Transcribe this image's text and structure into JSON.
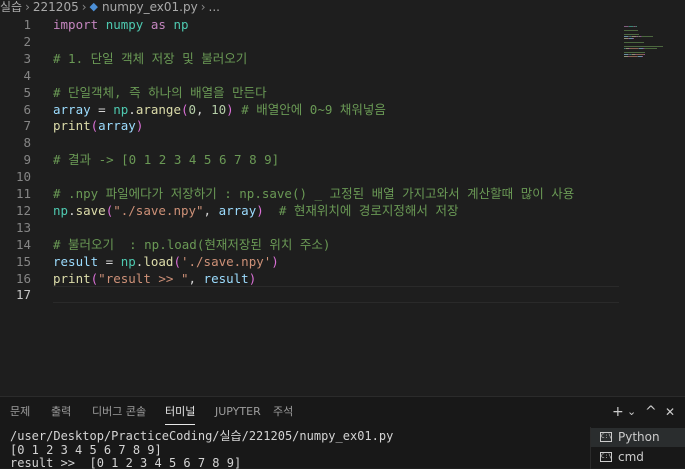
{
  "breadcrumb": {
    "items": [
      "실습",
      "221205",
      "numpy_ex01.py",
      "..."
    ]
  },
  "editor": {
    "lines": [
      {
        "n": "1",
        "tokens": [
          [
            "keyword",
            "import"
          ],
          [
            "plain",
            " "
          ],
          [
            "module",
            "numpy"
          ],
          [
            "plain",
            " "
          ],
          [
            "keyword",
            "as"
          ],
          [
            "plain",
            " "
          ],
          [
            "module",
            "np"
          ]
        ]
      },
      {
        "n": "2",
        "tokens": []
      },
      {
        "n": "3",
        "tokens": [
          [
            "comment",
            "# 1. 단일 객체 저장 및 불러오기"
          ]
        ]
      },
      {
        "n": "4",
        "tokens": []
      },
      {
        "n": "5",
        "tokens": [
          [
            "comment",
            "# 단일객체, 즉 하나의 배열을 만든다"
          ]
        ]
      },
      {
        "n": "6",
        "tokens": [
          [
            "var",
            "array"
          ],
          [
            "plain",
            " = "
          ],
          [
            "module",
            "np"
          ],
          [
            "plain",
            "."
          ],
          [
            "func",
            "arange"
          ],
          [
            "paren",
            "("
          ],
          [
            "num",
            "0"
          ],
          [
            "plain",
            ", "
          ],
          [
            "num",
            "10"
          ],
          [
            "paren",
            ")"
          ],
          [
            "plain",
            " "
          ],
          [
            "comment",
            "# 배열안에 0~9 채워넣음"
          ]
        ]
      },
      {
        "n": "7",
        "tokens": [
          [
            "func",
            "print"
          ],
          [
            "paren",
            "("
          ],
          [
            "var",
            "array"
          ],
          [
            "paren",
            ")"
          ]
        ]
      },
      {
        "n": "8",
        "tokens": []
      },
      {
        "n": "9",
        "tokens": [
          [
            "comment",
            "# 결과 -> [0 1 2 3 4 5 6 7 8 9]"
          ]
        ]
      },
      {
        "n": "10",
        "tokens": []
      },
      {
        "n": "11",
        "tokens": [
          [
            "comment",
            "# .npy 파일에다가 저장하기 : np.save() _ 고정된 배열 가지고와서 계산할때 많이 사용"
          ]
        ]
      },
      {
        "n": "12",
        "tokens": [
          [
            "module",
            "np"
          ],
          [
            "plain",
            "."
          ],
          [
            "func",
            "save"
          ],
          [
            "paren",
            "("
          ],
          [
            "str",
            "\"./save.npy\""
          ],
          [
            "plain",
            ", "
          ],
          [
            "var",
            "array"
          ],
          [
            "paren",
            ")"
          ],
          [
            "plain",
            "  "
          ],
          [
            "comment",
            "# 현재위치에 경로지정해서 저장"
          ]
        ]
      },
      {
        "n": "13",
        "tokens": []
      },
      {
        "n": "14",
        "tokens": [
          [
            "comment",
            "# 불러오기  : np.load(현재저장된 위치 주소)"
          ]
        ]
      },
      {
        "n": "15",
        "tokens": [
          [
            "var",
            "result"
          ],
          [
            "plain",
            " = "
          ],
          [
            "module",
            "np"
          ],
          [
            "plain",
            "."
          ],
          [
            "func",
            "load"
          ],
          [
            "paren",
            "("
          ],
          [
            "str",
            "'./save.npy'"
          ],
          [
            "paren",
            ")"
          ]
        ]
      },
      {
        "n": "16",
        "tokens": [
          [
            "func",
            "print"
          ],
          [
            "paren",
            "("
          ],
          [
            "str",
            "\"result >> \""
          ],
          [
            "plain",
            ", "
          ],
          [
            "var",
            "result"
          ],
          [
            "paren",
            ")"
          ]
        ]
      },
      {
        "n": "17",
        "tokens": []
      }
    ],
    "current_line": "17"
  },
  "panel": {
    "tabs": [
      "문제",
      "출력",
      "디버그 콘솔",
      "터미널",
      "JUPYTER",
      "주석"
    ],
    "active_tab": "터미널",
    "actions": {
      "add": "+",
      "dropdown": "⌄",
      "maximize": "^",
      "close": "✕"
    },
    "terminal_lines": [
      "/user/Desktop/PracticeCoding/실습/221205/numpy_ex01.py",
      "[0 1 2 3 4 5 6 7 8 9]",
      "result >>  [0 1 2 3 4 5 6 7 8 9]"
    ],
    "terminal_list": [
      {
        "label": "Python",
        "icon": "terminal-icon",
        "active": true
      },
      {
        "label": "cmd",
        "icon": "terminal-icon",
        "active": false
      }
    ]
  },
  "colors": {
    "background": "#1e1e1e",
    "comment": "#6a9955",
    "keyword": "#c586c0",
    "string": "#ce9178",
    "function": "#dcdcaa",
    "variable": "#9cdcfe"
  }
}
